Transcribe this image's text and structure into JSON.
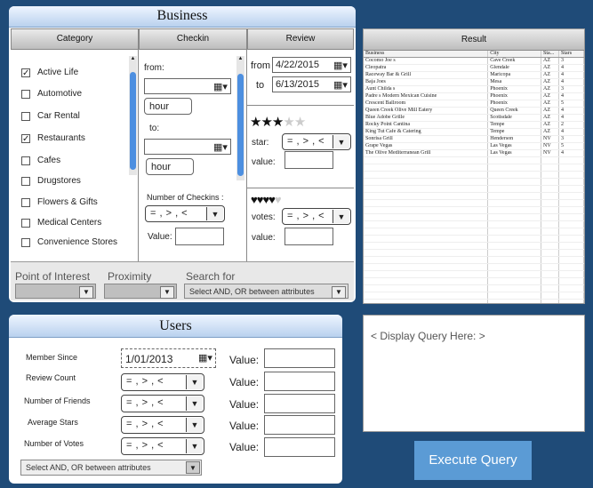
{
  "business": {
    "title": "Business",
    "headers": {
      "category": "Category",
      "checkin": "Checkin",
      "review": "Review"
    },
    "categories": [
      {
        "label": "Active Life",
        "checked": true
      },
      {
        "label": "Automotive",
        "checked": false
      },
      {
        "label": "Car Rental",
        "checked": false
      },
      {
        "label": "Restaurants",
        "checked": true
      },
      {
        "label": "Cafes",
        "checked": false
      },
      {
        "label": "Drugstores",
        "checked": false
      },
      {
        "label": "Flowers & Gifts",
        "checked": false
      },
      {
        "label": "Medical Centers",
        "checked": false
      },
      {
        "label": "Convenience Stores",
        "checked": false
      }
    ],
    "checkin": {
      "from_label": "from:",
      "to_label": "to:",
      "hour1": "hour",
      "hour2": "hour",
      "num_checkins_label": "Number of Checkins :",
      "operator": "= , > , <",
      "value_label": "Value:"
    },
    "review": {
      "from_label": "from",
      "from_date": "4/22/2015",
      "to_label": "to",
      "to_date": "6/13/2015",
      "stars_rating": 3,
      "stars_total": 5,
      "star_label": "star:",
      "star_operator": "= , > , <",
      "star_value_label": "value:",
      "hearts_rating": 4,
      "hearts_total": 5,
      "votes_label": "votes:",
      "votes_operator": "= , > , <",
      "votes_value_label": "value:"
    },
    "footer": {
      "poi_label": "Point of Interest",
      "proximity_label": "Proximity",
      "search_for_label": "Search for",
      "search_for_value": "Select AND, OR between attributes"
    }
  },
  "result": {
    "title": "Result",
    "columns": [
      "Business",
      "City",
      "Sta...",
      "Stars"
    ],
    "rows": [
      [
        "Cocomo Joe s",
        "Cave Creek",
        "AZ",
        "3"
      ],
      [
        "Cleopatra",
        "Glendale",
        "AZ",
        "4"
      ],
      [
        "Raceway Bar & Grill",
        "Maricopa",
        "AZ",
        "4"
      ],
      [
        "Baja Joes",
        "Mesa",
        "AZ",
        "4"
      ],
      [
        "Aunt Childa s",
        "Phoenix",
        "AZ",
        "3"
      ],
      [
        "Padre s Modern Mexican Cuisine",
        "Phoenix",
        "AZ",
        "4"
      ],
      [
        "Crescent Ballroom",
        "Phoenix",
        "AZ",
        "5"
      ],
      [
        "Queen Creek Olive Mill Eatery",
        "Queen Creek",
        "AZ",
        "4"
      ],
      [
        "Blue Adobe Grille",
        "Scottsdale",
        "AZ",
        "4"
      ],
      [
        "Rocky Point Cantina",
        "Tempe",
        "AZ",
        "2"
      ],
      [
        "King Tut Cafe & Catering",
        "Tempe",
        "AZ",
        "4"
      ],
      [
        "Sonrisa Grill",
        "Henderson",
        "NV",
        "3"
      ],
      [
        "Grape Vegas",
        "Las Vegas",
        "NV",
        "5"
      ],
      [
        "The Olive Mediterranean Grill",
        "Las Vegas",
        "NV",
        "4"
      ]
    ]
  },
  "users": {
    "title": "Users",
    "member_since_label": "Member Since",
    "member_since_date": "1/01/2013",
    "value_label": "Value:",
    "rows": [
      {
        "label": "Review Count",
        "operator": "= , > , <"
      },
      {
        "label": "Number of Friends",
        "operator": "= , > , <"
      },
      {
        "label": "Average Stars",
        "operator": "= , > , <"
      },
      {
        "label": "Number of Votes",
        "operator": "= , > , <"
      }
    ],
    "attr_select": "Select AND, OR between attributes"
  },
  "query": {
    "placeholder": "< Display Query Here: >",
    "execute_label": "Execute Query"
  },
  "colors": {
    "background": "#1f4b78",
    "execute_button": "#5b9bd5",
    "scroll_thumb": "#4d8fe0"
  },
  "icons": {
    "calendar": "calendar-icon",
    "dropdown": "chevron-down-icon",
    "check": "checkmark-icon"
  }
}
